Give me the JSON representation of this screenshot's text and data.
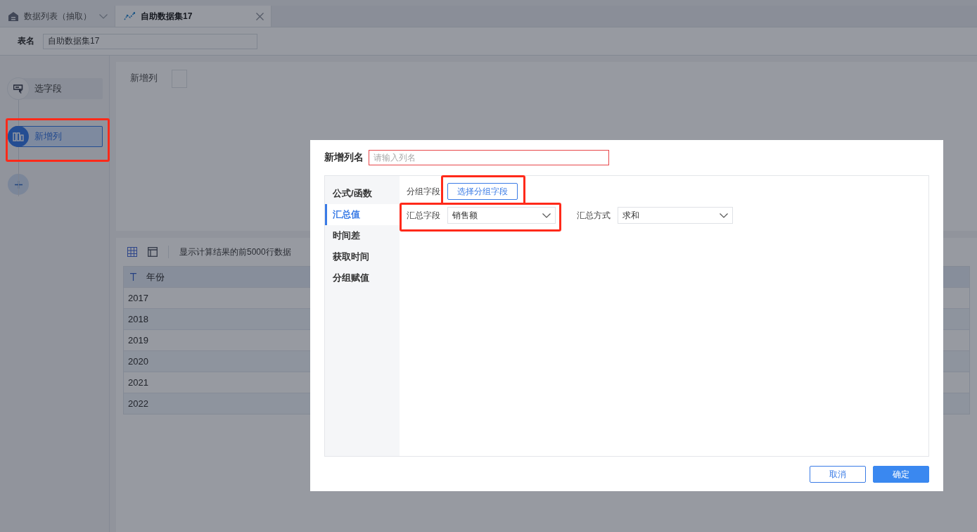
{
  "tabs": [
    {
      "label": "数据列表（抽取）",
      "kind": "home",
      "selected": false
    },
    {
      "label": "自助数据集17",
      "kind": "dataset",
      "selected": true
    }
  ],
  "table_name": {
    "label": "表名",
    "value": "自助数据集17"
  },
  "steps": [
    {
      "label": "选字段",
      "kind": "select",
      "selected": false,
      "highlighted": false
    },
    {
      "label": "新增列",
      "kind": "column",
      "selected": true,
      "highlighted": true
    }
  ],
  "preview": {
    "label": "新增列"
  },
  "toolbar": {
    "note": "显示计算结果的前5000行数据"
  },
  "table": {
    "columns": [
      {
        "label": "年份",
        "kind": "text"
      }
    ],
    "rows": [
      [
        "2017"
      ],
      [
        "2018"
      ],
      [
        "2019"
      ],
      [
        "2020"
      ],
      [
        "2021"
      ],
      [
        "2022"
      ]
    ]
  },
  "dialog": {
    "name_label": "新增列名",
    "name_placeholder": "请输入列名",
    "name_invalid": true,
    "menu": [
      {
        "label": "公式/函数",
        "selected": false
      },
      {
        "label": "汇总值",
        "selected": true
      },
      {
        "label": "时间差",
        "selected": false
      },
      {
        "label": "获取时间",
        "selected": false
      },
      {
        "label": "分组赋值",
        "selected": false
      }
    ],
    "group": {
      "label": "分组字段",
      "button": "选择分组字段",
      "highlighted": true
    },
    "summary_field": {
      "label": "汇总字段",
      "value": "销售额",
      "highlighted": true
    },
    "summary_method": {
      "label": "汇总方式",
      "value": "求和"
    },
    "buttons": [
      {
        "label": "取消",
        "kind": "secondary"
      },
      {
        "label": "确定",
        "kind": "primary"
      }
    ]
  }
}
